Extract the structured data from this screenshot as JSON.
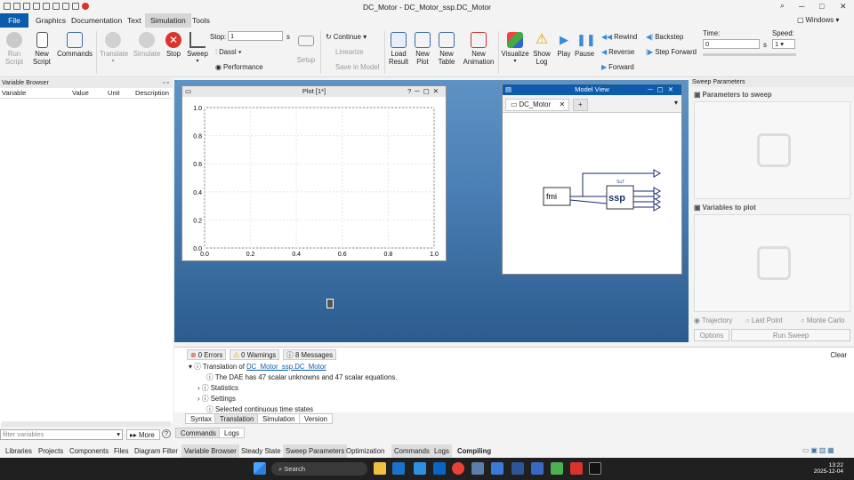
{
  "app": {
    "title": "DC_Motor - DC_Motor_ssp.DC_Motor",
    "windows_menu": "Windows"
  },
  "menus": [
    "File",
    "Graphics",
    "Documentation",
    "Text",
    "Simulation",
    "Tools"
  ],
  "ribbon": {
    "run_script": "Run\nScript",
    "new_script": "New\nScript",
    "commands": "Commands",
    "translate": "Translate",
    "simulate": "Simulate",
    "stop": "Stop",
    "sweep": "Sweep",
    "stop_label": "Stop:",
    "stop_value": "1",
    "stop_unit": "s",
    "solver": "Dassl",
    "performance": "Performance",
    "setup": "Setup",
    "continue": "Continue",
    "linearize": "Linearize",
    "save_in_model": "Save in Model",
    "load_result": "Load\nResult",
    "new_plot": "New\nPlot",
    "new_table": "New\nTable",
    "new_animation": "New\nAnimation",
    "visualize": "Visualize",
    "show_log": "Show\nLog",
    "play": "Play",
    "pause": "Pause",
    "rewind": "Rewind",
    "reverse": "Reverse",
    "forward": "Forward",
    "backstep": "Backstep",
    "step_forward": "Step Forward",
    "time_label": "Time:",
    "time_value": "0",
    "time_unit": "s",
    "speed_label": "Speed:",
    "speed_value": "1"
  },
  "variable_browser": {
    "title": "Variable Browser",
    "columns": [
      "Variable",
      "Value",
      "Unit",
      "Description"
    ],
    "filter_placeholder": "filter variables",
    "more": "More"
  },
  "plot": {
    "title": "Plot [1*]",
    "y_ticks": [
      "1.0",
      "0.8",
      "0.6",
      "0.4",
      "0.2",
      "0.0"
    ],
    "x_ticks": [
      "0.0",
      "0.2",
      "0.4",
      "0.6",
      "0.8",
      "1.0"
    ]
  },
  "model_view": {
    "title": "Model View",
    "tab": "DC_Motor",
    "fmi_label": "fmi",
    "ssp_label": "ssp",
    "sut_label": "SuT"
  },
  "sweep": {
    "title": "Sweep Parameters",
    "params": "Parameters to sweep",
    "vars": "Variables to plot",
    "modes": [
      "Trajectory",
      "Last Point",
      "Monte Carlo"
    ],
    "options": "Options",
    "run": "Run Sweep"
  },
  "messages": {
    "errors": "0 Errors",
    "warnings": "0 Warnings",
    "messages": "8 Messages",
    "clear": "Clear",
    "translation_prefix": "Translation of",
    "translation_link": "DC_Motor_ssp.DC_Motor",
    "lines": [
      "The DAE has 47 scalar unknowns and 47 scalar equations.",
      "Statistics",
      "Settings",
      "Selected continuous time states"
    ],
    "tabs": [
      "Syntax",
      "Translation",
      "Simulation",
      "Version"
    ],
    "sub_tabs": [
      "Commands",
      "Logs"
    ]
  },
  "bottom_tabs": [
    "Libraries",
    "Projects",
    "Components",
    "Files",
    "Diagram Filter",
    "Variable Browser",
    "Steady State",
    "Sweep Parameters",
    "Optimization",
    "Commands",
    "Logs",
    "Compiling"
  ],
  "taskbar": {
    "search": "Search",
    "time": "13:22",
    "date": "2025-12-04"
  }
}
